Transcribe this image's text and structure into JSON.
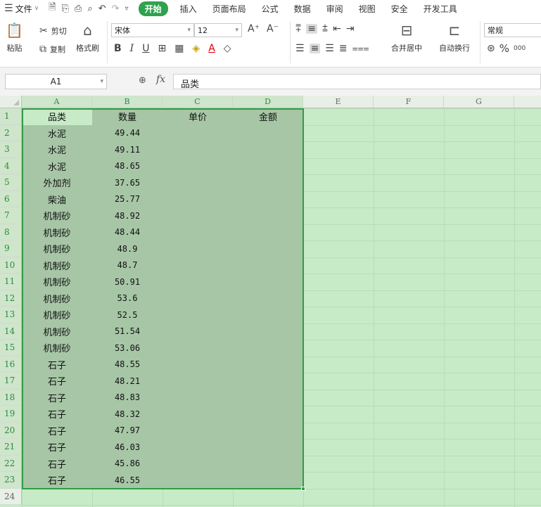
{
  "menubar": {
    "file_label": "文件",
    "tabs": [
      "开始",
      "插入",
      "页面布局",
      "公式",
      "数据",
      "审阅",
      "视图",
      "安全",
      "开发工具"
    ],
    "active_tab": "开始"
  },
  "ribbon": {
    "paste": "粘贴",
    "cut": "剪切",
    "copy": "复制",
    "format_painter": "格式刷",
    "font_name": "宋体",
    "font_size": "12",
    "merge_center": "合并居中",
    "wrap_text": "自动换行",
    "number_format": "常规",
    "percent": "%",
    "thousands": "000"
  },
  "formula_bar": {
    "name_box": "A1",
    "content": "品类",
    "fx": "fx"
  },
  "sheet": {
    "columns": [
      "A",
      "B",
      "C",
      "D",
      "E",
      "F",
      "G"
    ],
    "header": [
      "品类",
      "数量",
      "单价",
      "金额"
    ],
    "rows": [
      [
        "水泥",
        "49.44"
      ],
      [
        "水泥",
        "49.11"
      ],
      [
        "水泥",
        "48.65"
      ],
      [
        "外加剂",
        "37.65"
      ],
      [
        "柴油",
        "25.77"
      ],
      [
        "机制砂",
        "48.92"
      ],
      [
        "机制砂",
        "48.44"
      ],
      [
        "机制砂",
        "48.9"
      ],
      [
        "机制砂",
        "48.7"
      ],
      [
        "机制砂",
        "50.91"
      ],
      [
        "机制砂",
        "53.6"
      ],
      [
        "机制砂",
        "52.5"
      ],
      [
        "机制砂",
        "51.54"
      ],
      [
        "机制砂",
        "53.06"
      ],
      [
        "石子",
        "48.55"
      ],
      [
        "石子",
        "48.21"
      ],
      [
        "石子",
        "48.83"
      ],
      [
        "石子",
        "48.32"
      ],
      [
        "石子",
        "47.97"
      ],
      [
        "石子",
        "46.03"
      ],
      [
        "石子",
        "45.86"
      ],
      [
        "石子",
        "46.55"
      ]
    ],
    "row_numbers": [
      "1",
      "2",
      "3",
      "4",
      "5",
      "6",
      "7",
      "8",
      "9",
      "10",
      "11",
      "12",
      "13",
      "14",
      "15",
      "16",
      "17",
      "18",
      "19",
      "20",
      "21",
      "22",
      "23",
      "24"
    ]
  },
  "colors": {
    "accent": "#2fa24f",
    "sheet_bg": "#c7ebc7",
    "selected_cell_bg": "#a7c6a6"
  }
}
